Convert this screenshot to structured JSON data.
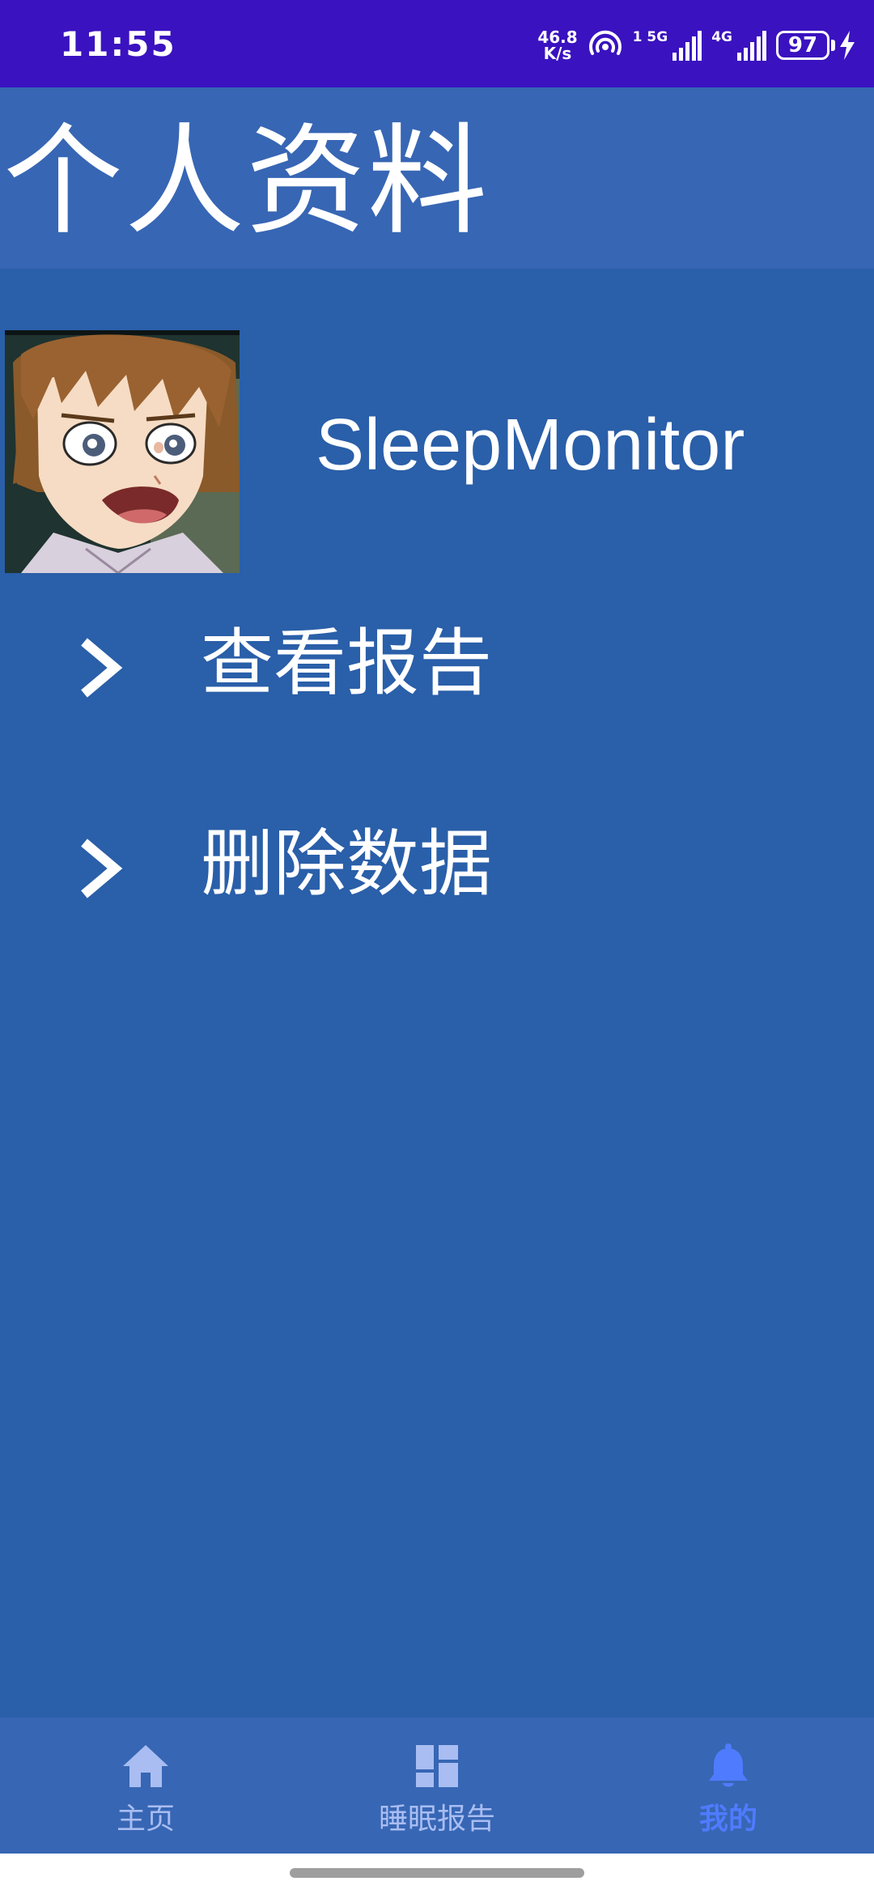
{
  "status_bar": {
    "time": "11:55",
    "net_speed_value": "46.8",
    "net_speed_unit": "K/s",
    "sim1_label": "1 5G",
    "sim2_label": "4G",
    "battery": "97"
  },
  "header": {
    "title": "个人资料"
  },
  "profile": {
    "username": "SleepMonitor"
  },
  "menu": {
    "items": [
      {
        "label": "查看报告",
        "icon": "chevron-right-icon"
      },
      {
        "label": "删除数据",
        "icon": "chevron-right-icon"
      }
    ]
  },
  "bottom_nav": {
    "items": [
      {
        "label": "主页",
        "icon": "home-icon",
        "active": false
      },
      {
        "label": "睡眠报告",
        "icon": "dashboard-icon",
        "active": false
      },
      {
        "label": "我的",
        "icon": "bell-icon",
        "active": true
      }
    ]
  },
  "colors": {
    "status_bar": "#3a12c0",
    "background": "#2a5fa9",
    "title_bar": "#3766b4",
    "nav_inactive": "#a9bdf2",
    "nav_active": "#4f7bff"
  }
}
